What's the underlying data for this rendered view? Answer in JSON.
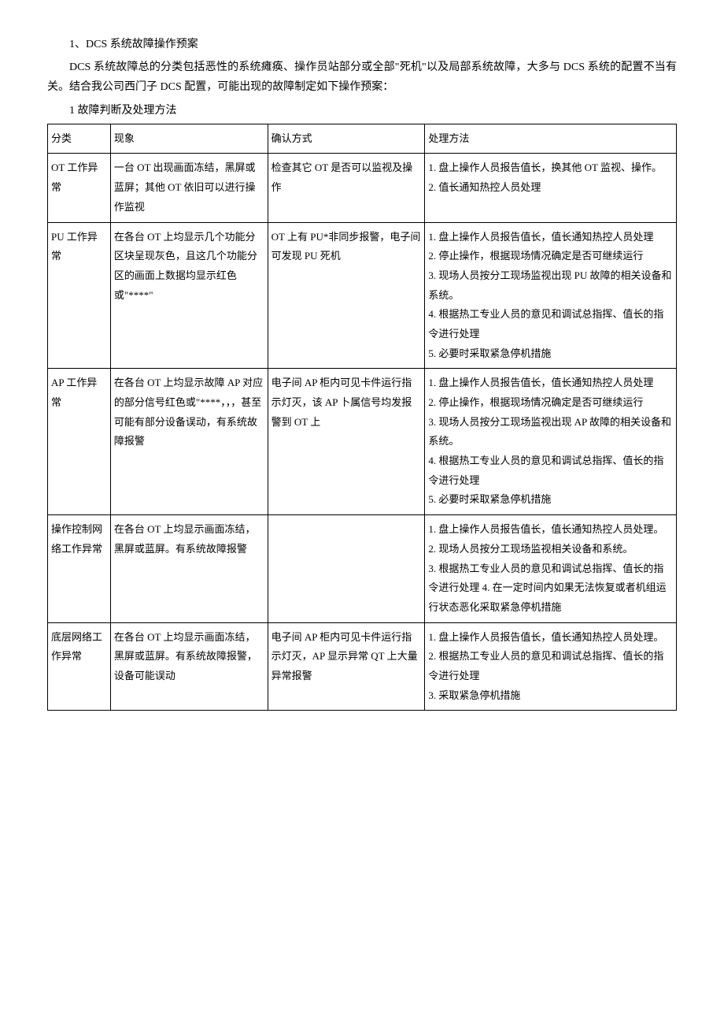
{
  "heading": "1、DCS 系统故障操作预案",
  "intro": "DCS 系统故障总的分类包括恶性的系统瘫痪、操作员站部分或全部\"死机\"以及局部系统故障，大多与 DCS 系统的配置不当有关。结合我公司西门子 DCS 配置，可能出现的故障制定如下操作预案：",
  "subheading": "1 故障判断及处理方法",
  "table": {
    "headers": {
      "col1": "分类",
      "col2": "现象",
      "col3": "确认方式",
      "col4": "处理方法"
    },
    "rows": [
      {
        "col1": "OT 工作异常",
        "col2": "一台 OT 出现画面冻结，黑屏或蓝屏；其他 OT 依旧可以进行操作监视",
        "col3": "检查其它 OT 是否可以监视及操作",
        "col4": "1. 盘上操作人员报告值长，换其他 OT 监视、操作。\n2. 值长通知热控人员处理"
      },
      {
        "col1": "PU 工作异常",
        "col2": "在各台 OT 上均显示几个功能分区块呈现灰色，且这几个功能分区的画面上数据均显示红色或\"****\"",
        "col3": "OT 上有 PU*非同步报警，电子间可发现 PU 死机",
        "col4": "1. 盘上操作人员报告值长，值长通知热控人员处理\n2. 停止操作，根据现场情况确定是否可继续运行\n3. 现场人员按分工现场监视出现 PU 故障的相关设备和系统。\n4. 根据热工专业人员的意见和调试总指挥、值长的指令进行处理\n5. 必要时采取紧急停机措施"
      },
      {
        "col1": "AP 工作异常",
        "col2": "在各台 OT 上均显示故障 AP 对应的部分信号红色或\"****，，，甚至可能有部分设备误动，有系统故障报警",
        "col3": "电子间 AP 柜内可见卡件运行指示灯灭，该 AP 卜属信号均发报警到 OT 上",
        "col4": "1. 盘上操作人员报告值长，值长通知热控人员处理\n2. 停止操作，根据现场情况确定是否可继续运行\n3. 现场人员按分工现场监视出现 AP 故障的相关设备和系统。\n4. 根据热工专业人员的意见和调试总指挥、值长的指令进行处理\n5. 必要时采取紧急停机措施"
      },
      {
        "col1": "操作控制网络工作异常",
        "col2": "在各台 OT 上均显示画面冻结，黑屏或蓝屏。有系统故障报警",
        "col3": "",
        "col4": "1. 盘上操作人员报告值长，值长通知热控人员处理。\n2. 现场人员按分工现场监视相关设备和系统。\n3. 根据热工专业人员的意见和调试总指挥、值长的指令进行处理 4. 在一定时间内如果无法恢复或者机组运行状态恶化采取紧急停机措施"
      },
      {
        "col1": "底层网络工作异常",
        "col2": "在各台 OT 上均显示画面冻结，黑屏或蓝屏。有系统故障报警，设备可能误动",
        "col3": "电子间 AP 柜内可见卡件运行指示灯灭，AP 显示异常 QT 上大量异常报警",
        "col4": "1. 盘上操作人员报告值长，值长通知热控人员处理。\n2. 根据热工专业人员的意见和调试总指挥、值长的指令进行处理\n3. 采取紧急停机措施"
      }
    ]
  }
}
